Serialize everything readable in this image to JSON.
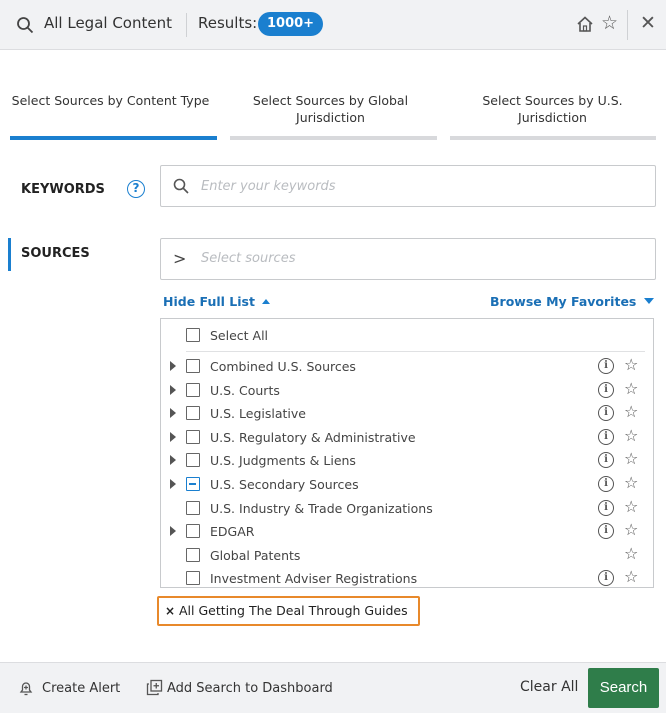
{
  "header": {
    "title": "All Legal Content",
    "results_label": "Results:",
    "results_count": "1000+",
    "icons": [
      "search-icon",
      "home-icon",
      "star-icon",
      "close-icon"
    ]
  },
  "tabs": [
    {
      "label": "Select Sources by Content Type",
      "active": true
    },
    {
      "label": "Select Sources by Global Jurisdiction",
      "active": false
    },
    {
      "label": "Select Sources by U.S. Jurisdiction",
      "active": false
    }
  ],
  "keywords": {
    "label": "KEYWORDS",
    "help": "?",
    "placeholder": "Enter your keywords",
    "value": ""
  },
  "sources": {
    "label": "SOURCES",
    "placeholder": "Select sources",
    "chevron": ">",
    "hide_full_list": "Hide Full List",
    "browse_favorites": "Browse My Favorites",
    "select_all": "Select All",
    "items": [
      {
        "label": "Combined U.S. Sources",
        "expandable": true,
        "state": "unchecked",
        "info": true
      },
      {
        "label": "U.S. Courts",
        "expandable": true,
        "state": "unchecked",
        "info": true
      },
      {
        "label": "U.S. Legislative",
        "expandable": true,
        "state": "unchecked",
        "info": true
      },
      {
        "label": "U.S. Regulatory & Administrative",
        "expandable": true,
        "state": "unchecked",
        "info": true
      },
      {
        "label": "U.S. Judgments & Liens",
        "expandable": true,
        "state": "unchecked",
        "info": true
      },
      {
        "label": "U.S. Secondary Sources",
        "expandable": true,
        "state": "partial",
        "info": true
      },
      {
        "label": "U.S. Industry & Trade Organizations",
        "expandable": false,
        "state": "unchecked",
        "info": true
      },
      {
        "label": "EDGAR",
        "expandable": true,
        "state": "unchecked",
        "info": true
      },
      {
        "label": "Global Patents",
        "expandable": false,
        "state": "unchecked",
        "info": false
      },
      {
        "label": "Investment Adviser Registrations",
        "expandable": false,
        "state": "unchecked",
        "info": true
      }
    ],
    "selected_chip": {
      "remove": "×",
      "label": "All Getting The Deal Through Guides"
    }
  },
  "footer": {
    "create_alert": "Create Alert",
    "add_dashboard": "Add Search to Dashboard",
    "clear_all": "Clear All",
    "search": "Search"
  },
  "colors": {
    "accent": "#1a7fcf",
    "search_button": "#2f7d4a",
    "chip_border": "#e8892b"
  }
}
